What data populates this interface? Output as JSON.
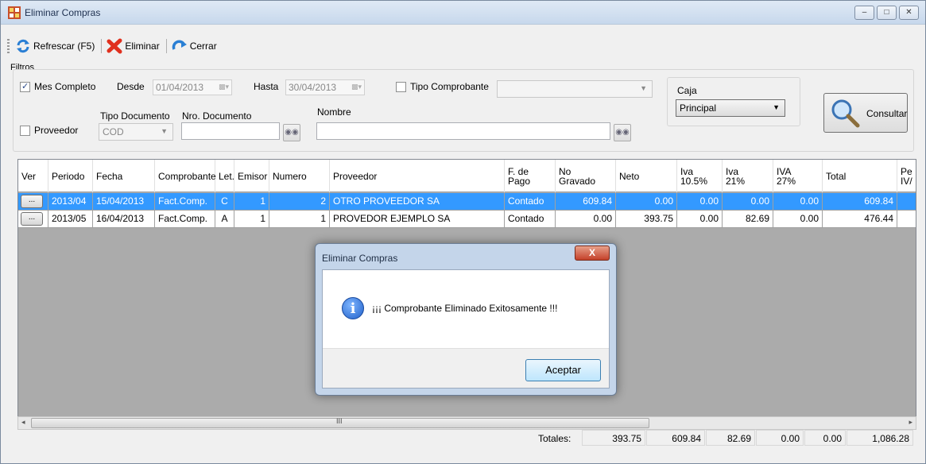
{
  "window": {
    "title": "Eliminar Compras",
    "controls": {
      "minimize": "–",
      "maximize": "□",
      "close": "✕"
    }
  },
  "toolbar": {
    "refresh_label": "Refrescar (F5)",
    "delete_label": "Eliminar",
    "close_label": "Cerrar"
  },
  "filters": {
    "group_label": "Filtros",
    "mes_completo_label": "Mes Completo",
    "mes_completo_checked": true,
    "desde_label": "Desde",
    "desde_value": "01/04/2013",
    "hasta_label": "Hasta",
    "hasta_value": "30/04/2013",
    "tipo_comprobante_label": "Tipo Comprobante",
    "tipo_comprobante_value": "",
    "proveedor_label": "Proveedor",
    "tipo_documento_label": "Tipo Documento",
    "tipo_documento_value": "COD",
    "nro_documento_label": "Nro. Documento",
    "nro_documento_value": "",
    "nombre_label": "Nombre",
    "nombre_value": "",
    "caja_label": "Caja",
    "caja_value": "Principal",
    "consultar_label": "Consultar"
  },
  "grid": {
    "columns": {
      "ver": "Ver",
      "periodo": "Periodo",
      "fecha": "Fecha",
      "comprobante": "Comprobante",
      "let": "Let.",
      "emisor": "Emisor",
      "numero": "Numero",
      "proveedor": "Proveedor",
      "fpago_1": "F. de",
      "fpago_2": "Pago",
      "nogravado_1": "No",
      "nogravado_2": "Gravado",
      "neto": "Neto",
      "iva105_1": "Iva",
      "iva105_2": "10.5%",
      "iva21_1": "Iva",
      "iva21_2": "21%",
      "iva27_1": "IVA",
      "iva27_2": "27%",
      "total": "Total",
      "per_1": "Pe",
      "per_2": "IV/"
    },
    "rows": [
      {
        "ver": "...",
        "periodo": "2013/04",
        "fecha": "15/04/2013",
        "comprobante": "Fact.Comp.",
        "let": "C",
        "emisor": "1",
        "numero": "2",
        "proveedor": "OTRO PROVEEDOR SA",
        "fpago": "Contado",
        "nogravado": "609.84",
        "neto": "0.00",
        "iva105": "0.00",
        "iva21": "0.00",
        "iva27": "0.00",
        "total": "609.84",
        "selected": true
      },
      {
        "ver": "...",
        "periodo": "2013/05",
        "fecha": "16/04/2013",
        "comprobante": "Fact.Comp.",
        "let": "A",
        "emisor": "1",
        "numero": "1",
        "proveedor": "PROVEDOR EJEMPLO SA",
        "fpago": "Contado",
        "nogravado": "0.00",
        "neto": "393.75",
        "iva105": "0.00",
        "iva21": "82.69",
        "iva27": "0.00",
        "total": "476.44",
        "selected": false
      }
    ]
  },
  "totals": {
    "label": "Totales:",
    "values": [
      "393.75",
      "609.84",
      "82.69",
      "0.00",
      "0.00",
      "1,086.28"
    ]
  },
  "dialog": {
    "title": "Eliminar Compras",
    "close": "X",
    "info": "i",
    "message": "¡¡¡ Comprobante Eliminado Exitosamente !!!",
    "accept_label": "Aceptar"
  },
  "scrollbar": {
    "left": "◂",
    "right": "▸",
    "grip": "III"
  },
  "colors": {
    "selection": "#3399ff",
    "grid_bg": "#ababab",
    "titlebar": "#c7d8ec"
  }
}
